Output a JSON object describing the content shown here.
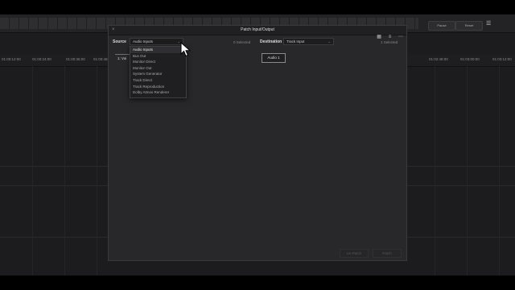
{
  "topbar": {
    "pause_label": "Pause",
    "reset_label": "Reset"
  },
  "ruler": {
    "timecodes": [
      "01:00:12:00",
      "01:00:24:00",
      "01:00:36:00",
      "01:00:48:00",
      "01:02:48:00",
      "01:03:00:00",
      "01:03:12:00"
    ]
  },
  "dialog": {
    "title": "Patch Input/Output",
    "close_glyph": "×",
    "view_icons": [
      "grid-view-icon",
      "list-view-icon",
      "more-options-icon"
    ],
    "source": {
      "label": "Source",
      "selected": "Audio Inputs",
      "count": "0 Selected",
      "chip": "1: Voi",
      "options": [
        {
          "label": "Audio Inputs",
          "selected": true
        },
        {
          "label": "Bus Out",
          "selected": false
        },
        {
          "label": "Monitor Direct",
          "selected": false
        },
        {
          "label": "Monitor Out",
          "selected": false
        },
        {
          "label": "System Generator",
          "selected": false
        },
        {
          "label": "Track Direct",
          "selected": false
        },
        {
          "label": "Track Reproduction",
          "selected": false
        },
        {
          "label": "Dolby Atmos Renderer",
          "selected": false
        }
      ]
    },
    "destination": {
      "label": "Destination",
      "selected": "Track Input",
      "count": "1 Selected",
      "chip": "Audio 1"
    },
    "footer": {
      "unpatch_label": "Un-Patch",
      "patch_label": "Patch"
    }
  },
  "colors": {
    "accent_green": "#3e8a5e",
    "dialog_bg": "#28282b",
    "background": "#1c1c1e"
  }
}
